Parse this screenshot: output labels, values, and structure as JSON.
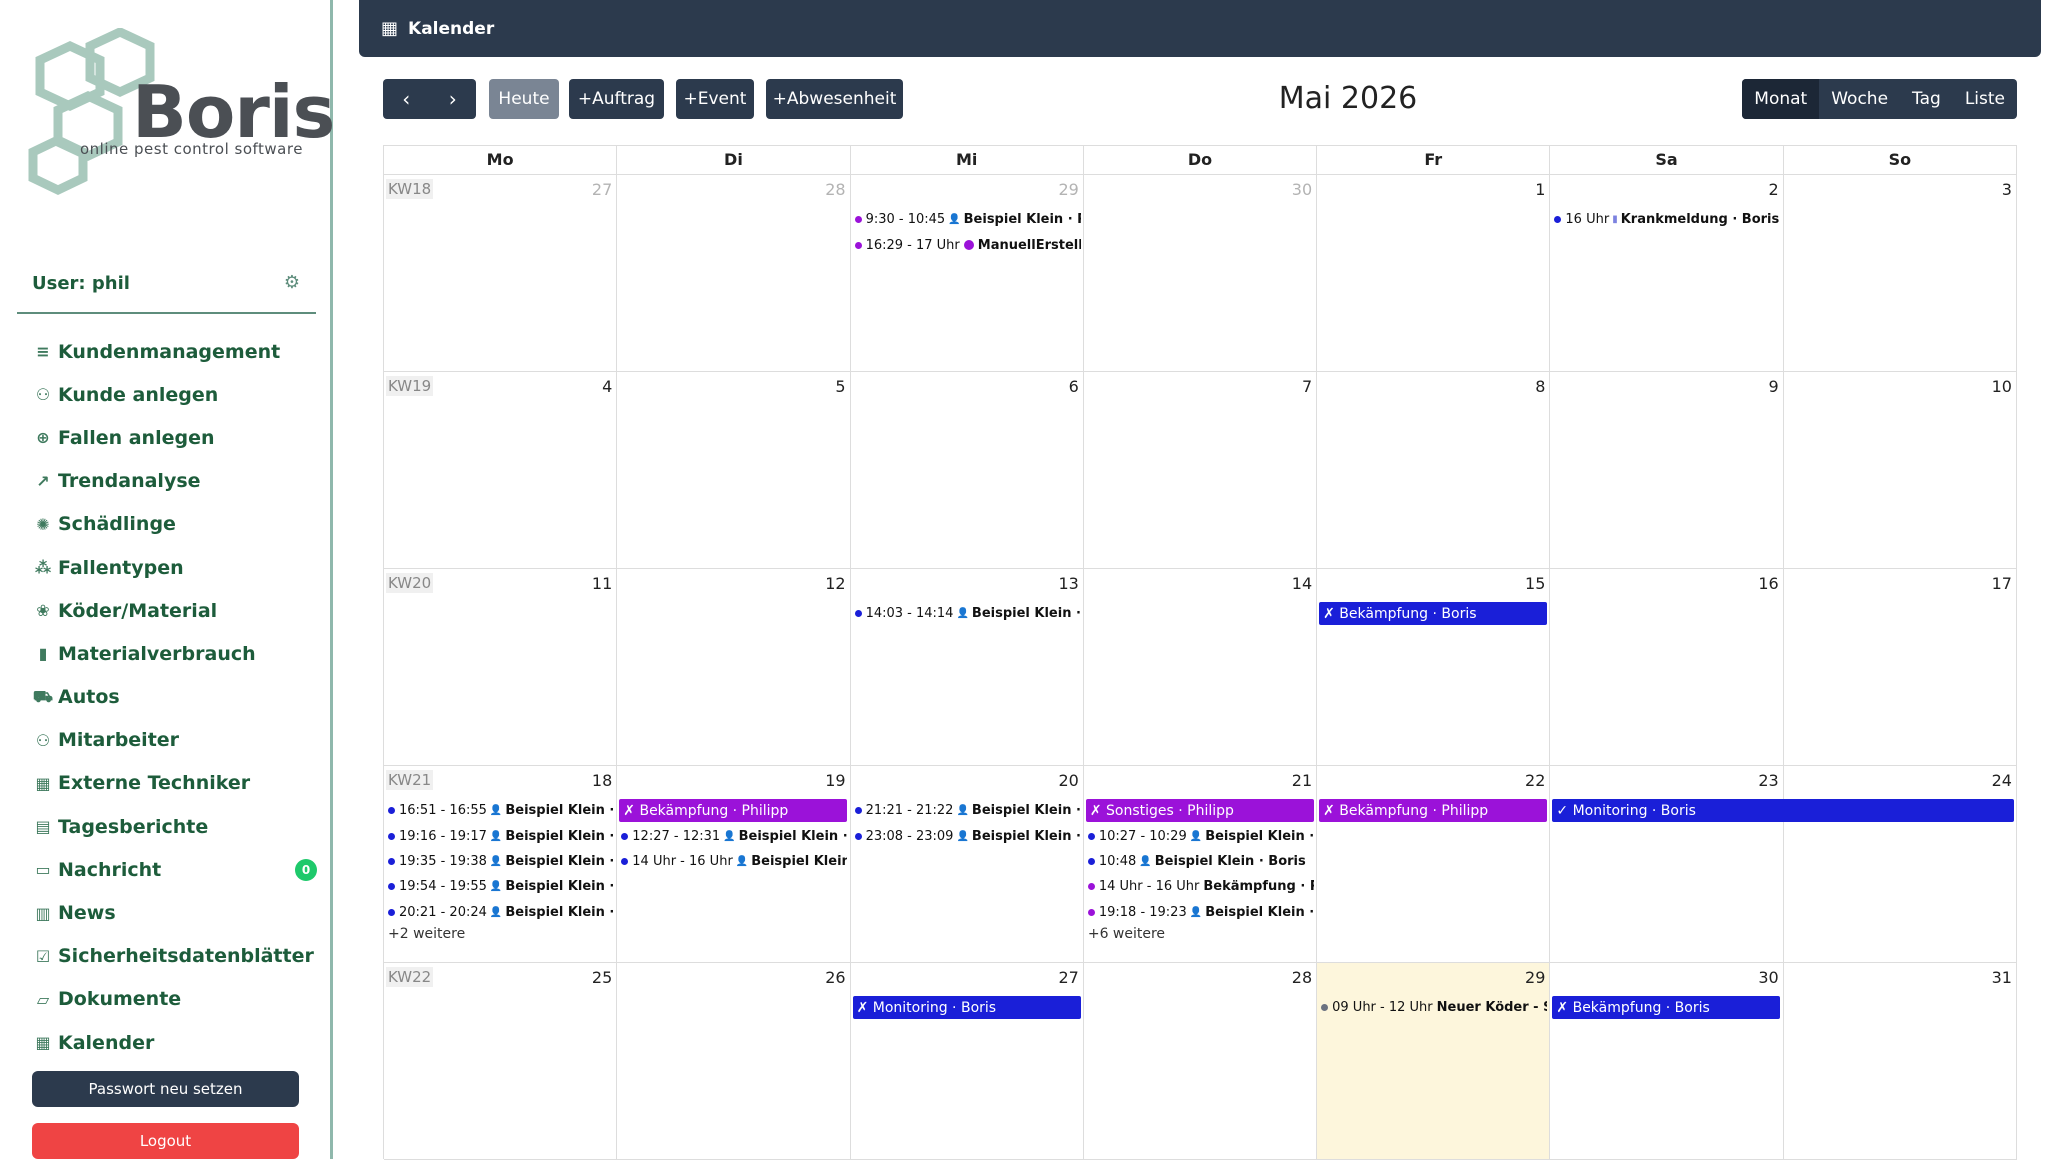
{
  "sidebar": {
    "brand": "Boris",
    "tagline": "online pest control software",
    "user_label": "User: phil",
    "items": [
      {
        "label": "Kundenmanagement",
        "icon": "≡"
      },
      {
        "label": "Kunde anlegen",
        "icon": "⚇"
      },
      {
        "label": "Fallen anlegen",
        "icon": "⊕"
      },
      {
        "label": "Trendanalyse",
        "icon": "↗"
      },
      {
        "label": "Schädlinge",
        "icon": "✺"
      },
      {
        "label": "Fallentypen",
        "icon": "⁂"
      },
      {
        "label": "Köder/Material",
        "icon": "❀"
      },
      {
        "label": "Materialverbrauch",
        "icon": "▮"
      },
      {
        "label": "Autos",
        "icon": "⛟"
      },
      {
        "label": "Mitarbeiter",
        "icon": "⚇"
      },
      {
        "label": "Externe Techniker",
        "icon": "▦"
      },
      {
        "label": "Tagesberichte",
        "icon": "▤"
      },
      {
        "label": "Nachricht",
        "icon": "▭",
        "badge": "0"
      },
      {
        "label": "News",
        "icon": "▥"
      },
      {
        "label": "Sicherheitsdatenblätter",
        "icon": "☑"
      },
      {
        "label": "Dokumente",
        "icon": "▱"
      },
      {
        "label": "Kalender",
        "icon": "▦"
      }
    ],
    "reset_password": "Passwort neu setzen",
    "logout": "Logout"
  },
  "topbar": {
    "title": "Kalender"
  },
  "toolbar": {
    "prev": "‹",
    "next": "›",
    "today": "Heute",
    "add_order": "+Auftrag",
    "add_event": "+Event",
    "add_absence": "+Abwesenheit",
    "month_title": "Mai 2026",
    "views": [
      "Monat",
      "Woche",
      "Tag",
      "Liste"
    ]
  },
  "calendar": {
    "weekdays": [
      "Mo",
      "Di",
      "Mi",
      "Do",
      "Fr",
      "Sa",
      "So"
    ],
    "weeks": [
      {
        "kw": "KW18",
        "days": [
          "27",
          "28",
          "29",
          "30",
          "1",
          "2",
          "3"
        ]
      },
      {
        "kw": "KW19",
        "days": [
          "4",
          "5",
          "6",
          "7",
          "8",
          "9",
          "10"
        ]
      },
      {
        "kw": "KW20",
        "days": [
          "11",
          "12",
          "13",
          "14",
          "15",
          "16",
          "17"
        ]
      },
      {
        "kw": "KW21",
        "days": [
          "18",
          "19",
          "20",
          "21",
          "22",
          "23",
          "24"
        ]
      },
      {
        "kw": "KW22",
        "days": [
          "25",
          "26",
          "27",
          "28",
          "29",
          "30",
          "31"
        ]
      }
    ],
    "events": {
      "w1_mi_1": {
        "time": "9:30 - 10:45",
        "title": "Beispiel Klein · Phi"
      },
      "w1_mi_2": {
        "time": "16:29 - 17 Uhr",
        "title": "ManuellErstellter"
      },
      "w1_sa_1": {
        "time": "16 Uhr",
        "title": "Krankmeldung · Boris"
      },
      "w3_mi_1": {
        "time": "14:03 - 14:14",
        "title": "Beispiel Klein · Bor"
      },
      "w3_fr_bar": "✗ Bekämpfung · Boris",
      "w4_mo_1": {
        "time": "16:51 - 16:55",
        "title": "Beispiel Klein · Bor"
      },
      "w4_mo_2": {
        "time": "19:16 - 19:17",
        "title": "Beispiel Klein · Bori"
      },
      "w4_mo_3": {
        "time": "19:35 - 19:38",
        "title": "Beispiel Klein · Bo"
      },
      "w4_mo_4": {
        "time": "19:54 - 19:55",
        "title": "Beispiel Klein · Bo"
      },
      "w4_mo_5": {
        "time": "20:21 - 20:24",
        "title": "Beispiel Klein · Bc"
      },
      "w4_mo_more": "+2 weitere",
      "w4_di_bar": "✗ Bekämpfung · Philipp",
      "w4_di_1": {
        "time": "12:27 - 12:31",
        "title": "Beispiel Klein · Bori"
      },
      "w4_di_2": {
        "time": "14 Uhr - 16 Uhr",
        "title": "Beispiel Klein · I"
      },
      "w4_mi_1": {
        "time": "21:21 - 21:22",
        "title": "Beispiel Klein · Bori"
      },
      "w4_mi_2": {
        "time": "23:08 - 23:09",
        "title": "Beispiel Klein · B"
      },
      "w4_do_bar": "✗ Sonstiges · Philipp",
      "w4_do_1": {
        "time": "10:27 - 10:29",
        "title": "Beispiel Klein · Bo"
      },
      "w4_do_2": {
        "time": "10:48",
        "title": "Beispiel Klein · Boris"
      },
      "w4_do_3": {
        "time": "14 Uhr - 16 Uhr",
        "title": "Bekämpfung · Ph"
      },
      "w4_do_4": {
        "time": "19:18 - 19:23",
        "title": "Beispiel Klein · Bor"
      },
      "w4_do_more": "+6 weitere",
      "w4_fr_bar": "✗ Bekämpfung · Philipp",
      "w4_sa_bar": "✓ Monitoring · Boris",
      "w5_mi_bar": "✗ Monitoring · Boris",
      "w5_fr_1": {
        "time": "09 Uhr - 12 Uhr",
        "title": "Neuer Köder - Sc"
      },
      "w5_sa_bar": "✗ Bekämpfung · Boris"
    },
    "colors": {
      "blue": "#1a1fd8",
      "purple": "#9b12d9",
      "today_bg": "#fdf6dc",
      "header_dark": "#2c3a4d"
    }
  }
}
